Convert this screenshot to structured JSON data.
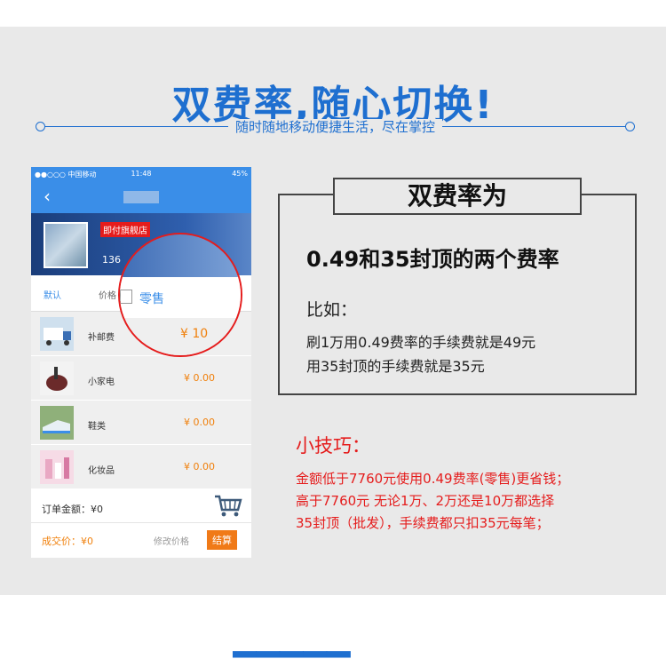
{
  "header": {
    "title": "双费率,随心切换!",
    "subtitle": "随时随地移动便捷生活，尽在掌控"
  },
  "phone": {
    "status": {
      "carrier": "●●○○○ 中国移动",
      "time": "11:48",
      "battery": "45%"
    },
    "nav": {
      "back_icon": "chevron-left-icon"
    },
    "shop": {
      "tag": "即付旗舰店",
      "id_partial": "136"
    },
    "tabs": {
      "default": "默认",
      "price": "价格"
    },
    "zoom": {
      "option_label": "零售",
      "price_partial": "¥ 10"
    },
    "products": [
      {
        "name": "补邮费",
        "price": ""
      },
      {
        "name": "小家电",
        "price": "¥ 0.00"
      },
      {
        "name": "鞋类",
        "price": "¥ 0.00"
      },
      {
        "name": "化妆品",
        "price": "¥ 0.00"
      }
    ],
    "footer": {
      "order_amount": "订单金额：¥0",
      "deal_price": "成交价：¥0",
      "edit_price": "修改价格",
      "checkout": "结算"
    }
  },
  "rate": {
    "heading": "双费率为",
    "description": "0.49和35封顶的两个费率",
    "example_label": "比如：",
    "line1": "刷1万用0.49费率的手续费就是49元",
    "line2": "用35封顶的手续费就是35元"
  },
  "tips": {
    "title": "小技巧：",
    "lines": [
      "金额低于7760元使用0.49费率(零售)更省钱；",
      "高于7760元 无论1万、2万还是10万都选择",
      "35封顶（批发），手续费都只扣35元每笔；"
    ]
  },
  "colors": {
    "brand_blue": "#1e6fd0",
    "accent_red": "#e51c1c",
    "orange": "#f07a18"
  }
}
